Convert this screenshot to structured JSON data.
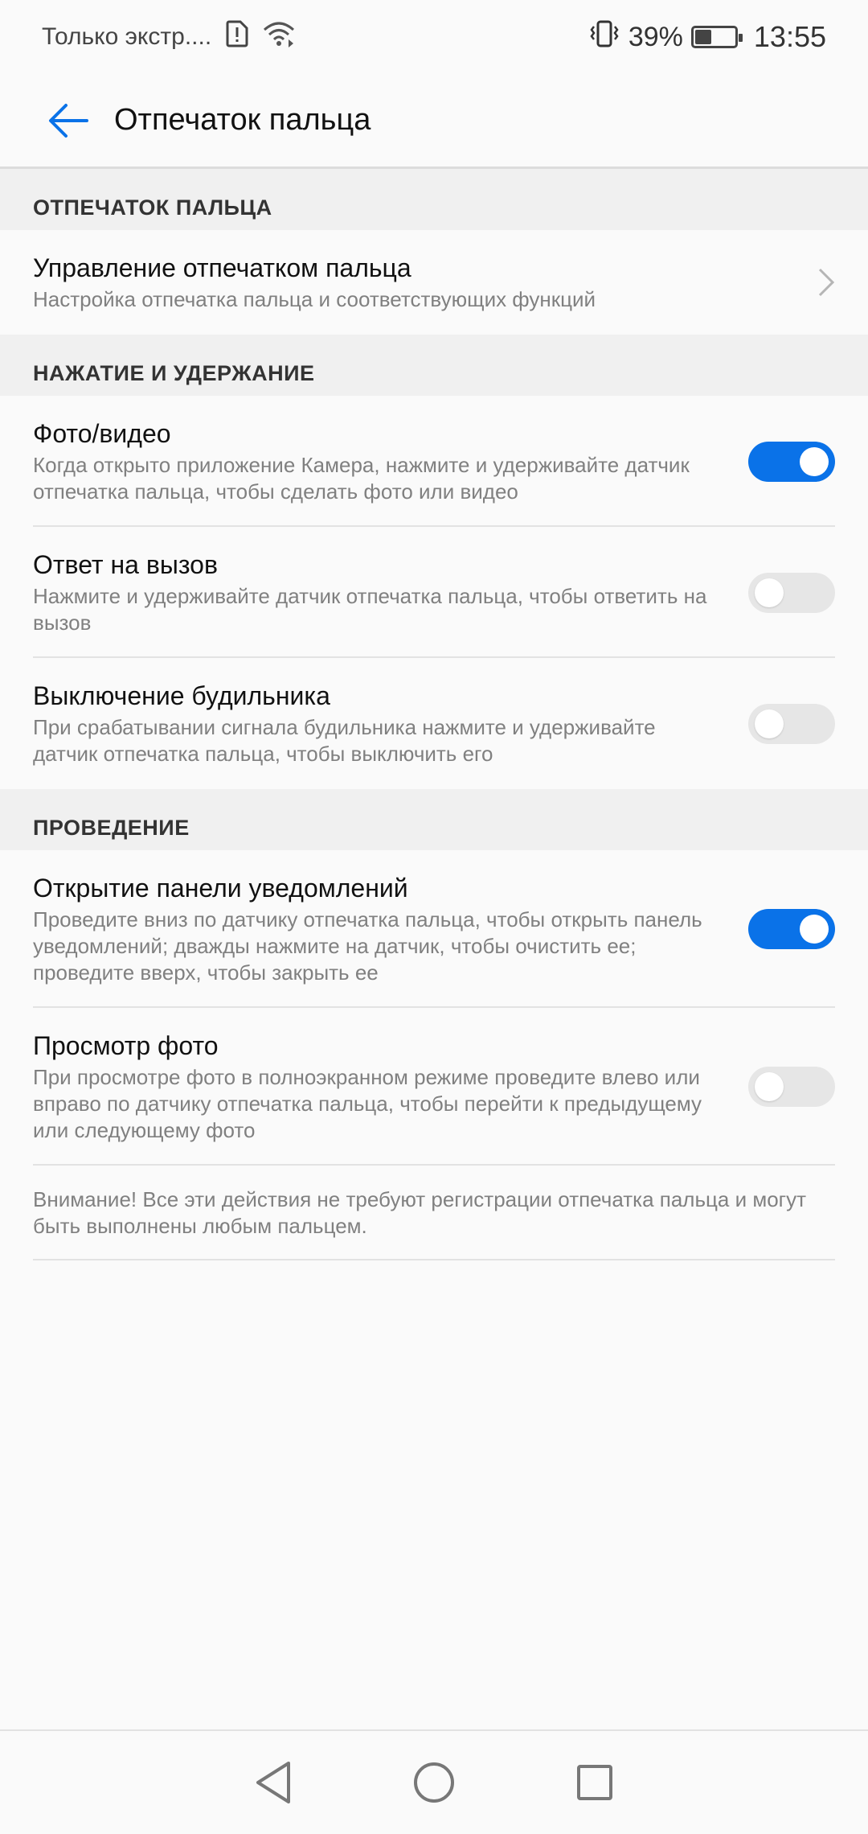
{
  "status_bar": {
    "carrier": "Только экстр....",
    "battery_percent": "39%",
    "battery_level": 0.39,
    "time": "13:55"
  },
  "app_bar": {
    "title": "Отпечаток пальца"
  },
  "sections": {
    "fingerprint": {
      "header": "ОТПЕЧАТОК ПАЛЬЦА",
      "manage": {
        "title": "Управление отпечатком пальца",
        "subtitle": "Настройка отпечатка пальца и соответствующих функций"
      }
    },
    "press_hold": {
      "header": "НАЖАТИЕ И УДЕРЖАНИЕ",
      "items": [
        {
          "title": "Фото/видео",
          "subtitle": "Когда открыто приложение Камера, нажмите и удерживайте датчик отпечатка пальца, чтобы сделать фото или видео",
          "enabled": true
        },
        {
          "title": "Ответ на вызов",
          "subtitle": "Нажмите и удерживайте датчик отпечатка пальца, чтобы ответить на вызов",
          "enabled": false
        },
        {
          "title": "Выключение будильника",
          "subtitle": "При срабатывании сигнала будильника нажмите и удерживайте датчик отпечатка пальца, чтобы выключить его",
          "enabled": false
        }
      ]
    },
    "swipe": {
      "header": "ПРОВЕДЕНИЕ",
      "items": [
        {
          "title": "Открытие панели уведомлений",
          "subtitle": "Проведите вниз по датчику отпечатка пальца, чтобы открыть панель уведомлений; дважды нажмите на датчик, чтобы очистить ее; проведите вверх, чтобы закрыть ее",
          "enabled": true
        },
        {
          "title": "Просмотр фото",
          "subtitle": "При просмотре фото в полноэкранном режиме проведите влево или вправо по датчику отпечатка пальца, чтобы перейти к предыдущему или следующему фото",
          "enabled": false
        }
      ]
    }
  },
  "note": "Внимание! Все эти действия не требуют регистрации отпечатка пальца и могут быть выполнены любым пальцем.",
  "colors": {
    "accent": "#0a72e8",
    "toggle_off": "#e6e6e6"
  },
  "icons": {
    "back": "arrow-left-icon",
    "chevron": "chevron-right-icon",
    "nav_back": "triangle-back-icon",
    "nav_home": "circle-home-icon",
    "nav_recent": "square-recent-icon"
  }
}
